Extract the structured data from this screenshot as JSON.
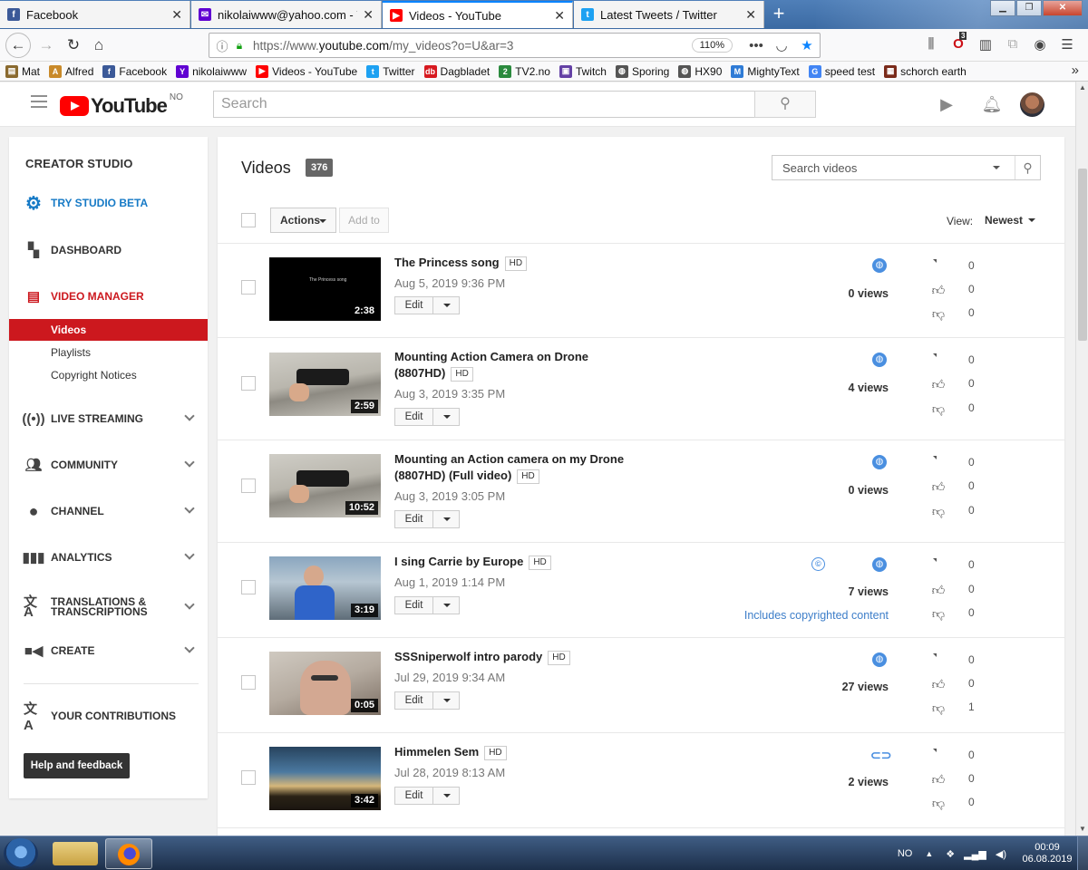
{
  "browser": {
    "tabs": [
      {
        "label": "Facebook",
        "icon": "facebook-icon",
        "color": "#3b5998"
      },
      {
        "label": "nikolaiwww@yahoo.com - Yah",
        "icon": "mail-icon",
        "color": "#6001d2"
      },
      {
        "label": "Videos - YouTube",
        "icon": "youtube-icon",
        "color": "#ff0000"
      },
      {
        "label": "Latest Tweets / Twitter",
        "icon": "twitter-icon",
        "color": "#1da1f2"
      }
    ],
    "new_tab": "+",
    "url_host": "https://www.",
    "url_domain": "youtube.com",
    "url_path": "/my_videos?o=U&ar=3",
    "zoom": "110%",
    "extension_badge": "3",
    "bookmarks": [
      {
        "label": "Mat",
        "icon": "folder-icon",
        "color": "#8a6a2f"
      },
      {
        "label": "Alfred",
        "icon": "alfred-icon",
        "color": "#c98a2a"
      },
      {
        "label": "Facebook",
        "icon": "facebook-icon",
        "color": "#3b5998"
      },
      {
        "label": "nikolaiwww",
        "icon": "yahoo-icon",
        "color": "#6001d2"
      },
      {
        "label": "Videos - YouTube",
        "icon": "youtube-icon",
        "color": "#ff0000"
      },
      {
        "label": "Twitter",
        "icon": "twitter-icon",
        "color": "#1da1f2"
      },
      {
        "label": "Dagbladet",
        "icon": "dagbladet-icon",
        "color": "#d71920"
      },
      {
        "label": "TV2.no",
        "icon": "tv2-icon",
        "color": "#2b8a3e"
      },
      {
        "label": "Twitch",
        "icon": "twitch-icon",
        "color": "#6441a5"
      },
      {
        "label": "Sporing",
        "icon": "globe-icon",
        "color": "#555555"
      },
      {
        "label": "HX90",
        "icon": "globe-icon",
        "color": "#555555"
      },
      {
        "label": "MightyText",
        "icon": "mightytext-icon",
        "color": "#2f7bd6"
      },
      {
        "label": "speed test",
        "icon": "google-icon",
        "color": "#4285f4"
      },
      {
        "label": "schorch earth",
        "icon": "game-icon",
        "color": "#7a2a1a"
      }
    ]
  },
  "youtube": {
    "logo_text": "YouTube",
    "country_code": "NO",
    "search_placeholder": "Search"
  },
  "sidebar": {
    "title": "CREATOR STUDIO",
    "items": [
      {
        "label": "TRY STUDIO BETA",
        "icon": "gear-icon",
        "color": "#167ac6"
      },
      {
        "label": "DASHBOARD",
        "icon": "dashboard-icon"
      },
      {
        "label": "VIDEO MANAGER",
        "icon": "video-manager-icon",
        "color": "#cc181e"
      },
      {
        "label": "LIVE STREAMING",
        "icon": "broadcast-icon"
      },
      {
        "label": "COMMUNITY",
        "icon": "people-icon"
      },
      {
        "label": "CHANNEL",
        "icon": "account-icon"
      },
      {
        "label": "ANALYTICS",
        "icon": "bar-chart-icon"
      },
      {
        "label": "TRANSLATIONS & TRANSCRIPTIONS",
        "icon": "translate-icon"
      },
      {
        "label": "CREATE",
        "icon": "video-camera-icon"
      },
      {
        "label": "YOUR CONTRIBUTIONS",
        "icon": "translate-icon"
      }
    ],
    "subitems": [
      "Videos",
      "Playlists",
      "Copyright Notices"
    ],
    "help_button": "Help and feedback"
  },
  "main": {
    "title": "Videos",
    "count": "376",
    "search_placeholder": "Search videos",
    "actions_label": "Actions",
    "add_to_label": "Add to",
    "view_label": "View:",
    "view_value": "Newest",
    "edit_label": "Edit",
    "hd_label": "HD",
    "videos": [
      {
        "title": "The Princess song",
        "hd": "HD",
        "date": "Aug 5, 2019 9:36 PM",
        "duration": "2:38",
        "views": "0 views",
        "comments": "0",
        "likes": "0",
        "dislikes": "0",
        "visibility": "public",
        "thumb_text": "The Princess song"
      },
      {
        "title": "Mounting Action Camera on Drone (8807HD)",
        "hd": "HD",
        "date": "Aug 3, 2019 3:35 PM",
        "duration": "2:59",
        "views": "4 views",
        "comments": "0",
        "likes": "0",
        "dislikes": "0",
        "visibility": "public"
      },
      {
        "title": "Mounting an Action camera on my Drone (8807HD) (Full video)",
        "hd": "HD",
        "date": "Aug 3, 2019 3:05 PM",
        "duration": "10:52",
        "views": "0 views",
        "comments": "0",
        "likes": "0",
        "dislikes": "0",
        "visibility": "public"
      },
      {
        "title": "I sing Carrie by Europe",
        "hd": "HD",
        "date": "Aug 1, 2019 1:14 PM",
        "duration": "3:19",
        "views": "7 views",
        "comments": "0",
        "likes": "0",
        "dislikes": "0",
        "visibility": "public",
        "copyright_note": "Includes copyrighted content"
      },
      {
        "title": "SSSniperwolf intro parody",
        "hd": "HD",
        "date": "Jul 29, 2019 9:34 AM",
        "duration": "0:05",
        "views": "27 views",
        "comments": "0",
        "likes": "0",
        "dislikes": "1",
        "visibility": "public"
      },
      {
        "title": "Himmelen Sem",
        "hd": "HD",
        "date": "Jul 28, 2019 8:13 AM",
        "duration": "3:42",
        "views": "2 views",
        "comments": "0",
        "likes": "0",
        "dislikes": "0",
        "visibility": "unlisted"
      }
    ]
  },
  "taskbar": {
    "language": "NO",
    "time": "00:09",
    "date": "06.08.2019"
  }
}
